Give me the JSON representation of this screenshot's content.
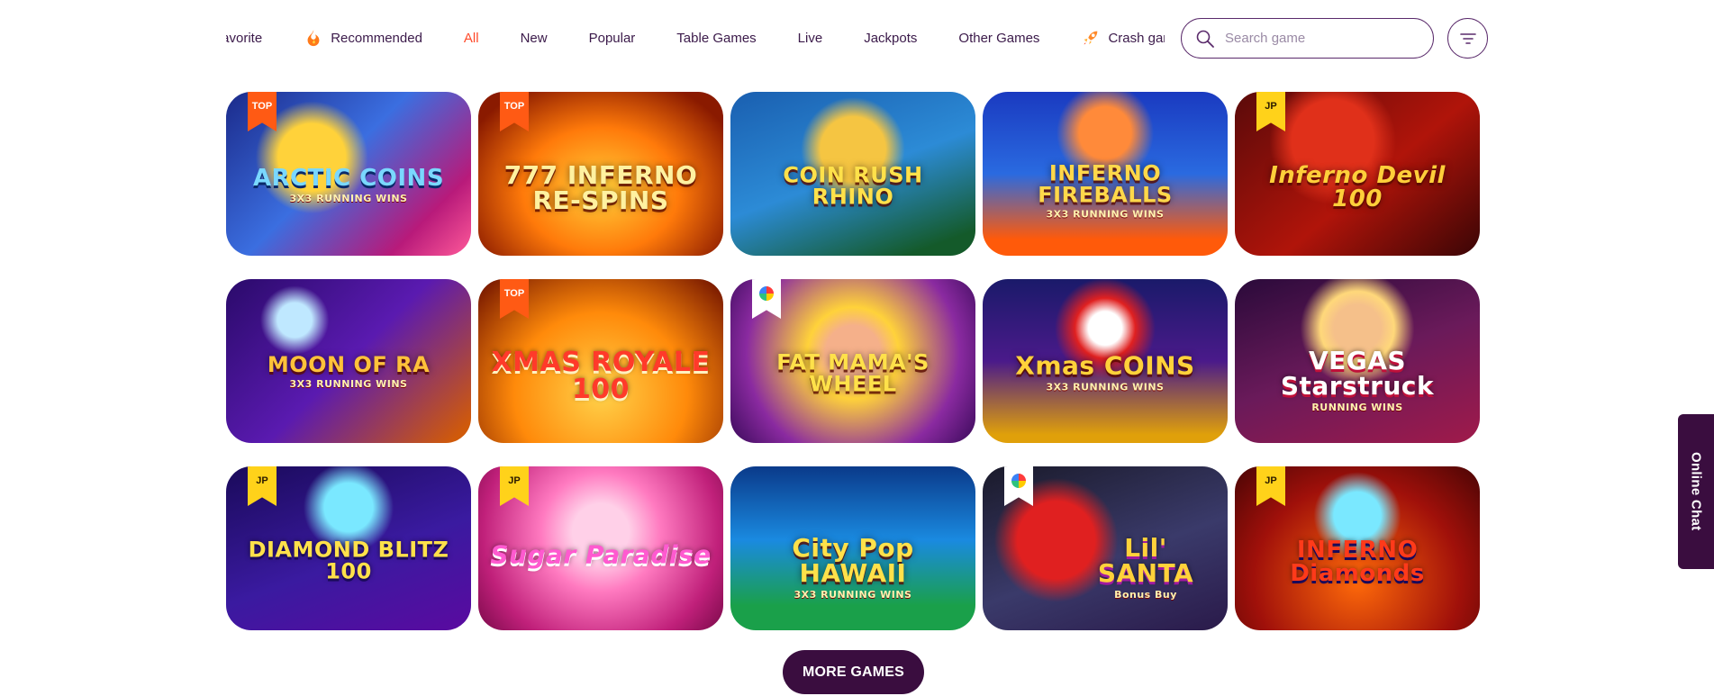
{
  "categories": {
    "items": [
      {
        "label": "Favorite",
        "active": false,
        "icon": null
      },
      {
        "label": "Recommended",
        "active": false,
        "icon": "flame-icon"
      },
      {
        "label": "All",
        "active": true,
        "icon": null
      },
      {
        "label": "New",
        "active": false,
        "icon": null
      },
      {
        "label": "Popular",
        "active": false,
        "icon": null
      },
      {
        "label": "Table Games",
        "active": false,
        "icon": null
      },
      {
        "label": "Live",
        "active": false,
        "icon": null
      },
      {
        "label": "Jackpots",
        "active": false,
        "icon": null
      },
      {
        "label": "Other Games",
        "active": false,
        "icon": null
      },
      {
        "label": "Crash games",
        "active": false,
        "icon": "rocket-icon"
      }
    ],
    "active_color": "#ff4a2a"
  },
  "search": {
    "placeholder": "Search game"
  },
  "games": [
    {
      "name": "ARCTIC COINS",
      "sub": "3X3 RUNNING WINS",
      "badge": "TOP"
    },
    {
      "name": "777 INFERNO RE-SPINS",
      "sub": "",
      "badge": "TOP"
    },
    {
      "name": "COIN RUSH RHINO",
      "sub": "",
      "badge": ""
    },
    {
      "name": "INFERNO FIREBALLS",
      "sub": "3X3 RUNNING WINS",
      "badge": ""
    },
    {
      "name": "Inferno Devil 100",
      "sub": "",
      "badge": "JP"
    },
    {
      "name": "MOON OF RA",
      "sub": "3X3 RUNNING WINS",
      "badge": ""
    },
    {
      "name": "XMAS ROYALE 100",
      "sub": "",
      "badge": "TOP"
    },
    {
      "name": "FAT MAMA'S WHEEL",
      "sub": "",
      "badge": "PROVIDER"
    },
    {
      "name": "Xmas COINS",
      "sub": "3X3 RUNNING WINS",
      "badge": ""
    },
    {
      "name": "VEGAS Starstruck",
      "sub": "RUNNING WINS",
      "badge": ""
    },
    {
      "name": "DIAMOND BLITZ 100",
      "sub": "",
      "badge": "JP"
    },
    {
      "name": "Sugar Paradise",
      "sub": "",
      "badge": "JP"
    },
    {
      "name": "City Pop HAWAII",
      "sub": "3X3 RUNNING WINS",
      "badge": ""
    },
    {
      "name": "Lil' SANTA",
      "sub": "Bonus Buy",
      "badge": "PROVIDER"
    },
    {
      "name": "INFERNO Diamonds",
      "sub": "",
      "badge": "JP"
    }
  ],
  "more_button": {
    "label": "MORE GAMES"
  },
  "chat": {
    "label": "Online Chat"
  }
}
